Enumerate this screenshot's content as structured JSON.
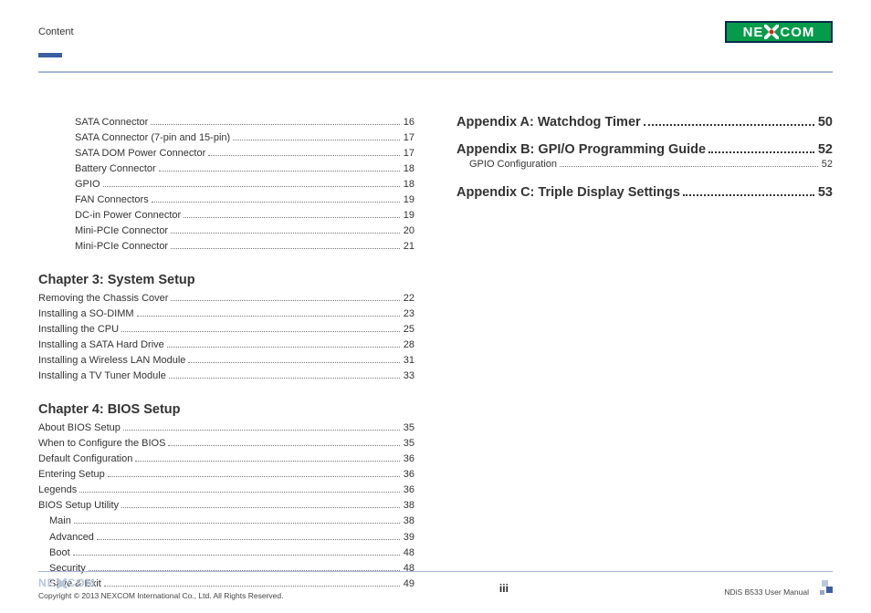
{
  "header": {
    "label": "Content",
    "logo": "NEXCOM"
  },
  "col1": {
    "pre": [
      {
        "label": "SATA Connector",
        "page": "16",
        "indent": 1
      },
      {
        "label": "SATA Connector (7-pin and 15-pin)",
        "page": "17",
        "indent": 1
      },
      {
        "label": "SATA DOM Power Connector",
        "page": "17",
        "indent": 1
      },
      {
        "label": "Battery Connector",
        "page": "18",
        "indent": 1
      },
      {
        "label": "GPIO",
        "page": "18",
        "indent": 1
      },
      {
        "label": "FAN Connectors",
        "page": "19",
        "indent": 1
      },
      {
        "label": "DC-in Power Connector",
        "page": "19",
        "indent": 1
      },
      {
        "label": "Mini-PCIe Connector",
        "page": "20",
        "indent": 1
      },
      {
        "label": "Mini-PCIe Connector",
        "page": "21",
        "indent": 1
      }
    ],
    "ch3": {
      "title": "Chapter 3: System Setup",
      "items": [
        {
          "label": "Removing the Chassis Cover",
          "page": "22"
        },
        {
          "label": "Installing a SO-DIMM",
          "page": "23"
        },
        {
          "label": "Installing the CPU",
          "page": "25"
        },
        {
          "label": "Installing a SATA Hard Drive",
          "page": "28"
        },
        {
          "label": "Installing a Wireless LAN Module",
          "page": "31"
        },
        {
          "label": "Installing a TV Tuner Module",
          "page": "33"
        }
      ]
    },
    "ch4": {
      "title": "Chapter 4: BIOS Setup",
      "items": [
        {
          "label": "About BIOS Setup",
          "page": "35"
        },
        {
          "label": "When to Configure the BIOS",
          "page": "35"
        },
        {
          "label": "Default Configuration",
          "page": "36"
        },
        {
          "label": "Entering Setup",
          "page": "36"
        },
        {
          "label": "Legends",
          "page": "36"
        },
        {
          "label": "BIOS Setup Utility",
          "page": "38"
        },
        {
          "label": "Main",
          "page": "38",
          "sub": true
        },
        {
          "label": "Advanced",
          "page": "39",
          "sub": true
        },
        {
          "label": "Boot",
          "page": "48",
          "sub": true
        },
        {
          "label": "Security",
          "page": "48",
          "sub": true
        },
        {
          "label": "Save & Exit",
          "page": "49",
          "sub": true
        }
      ]
    }
  },
  "col2": {
    "appA": {
      "label": "Appendix A: Watchdog Timer",
      "page": "50"
    },
    "appB": {
      "label": "Appendix B: GPI/O Programming Guide",
      "page": "52",
      "items": [
        {
          "label": "GPIO Configuration",
          "page": "52"
        }
      ]
    },
    "appC": {
      "label": "Appendix C: Triple Display Settings",
      "page": "53"
    }
  },
  "footer": {
    "copyright": "Copyright © 2013 NEXCOM International Co., Ltd. All Rights Reserved.",
    "page": "iii",
    "doc": "NDiS B533 User Manual"
  }
}
